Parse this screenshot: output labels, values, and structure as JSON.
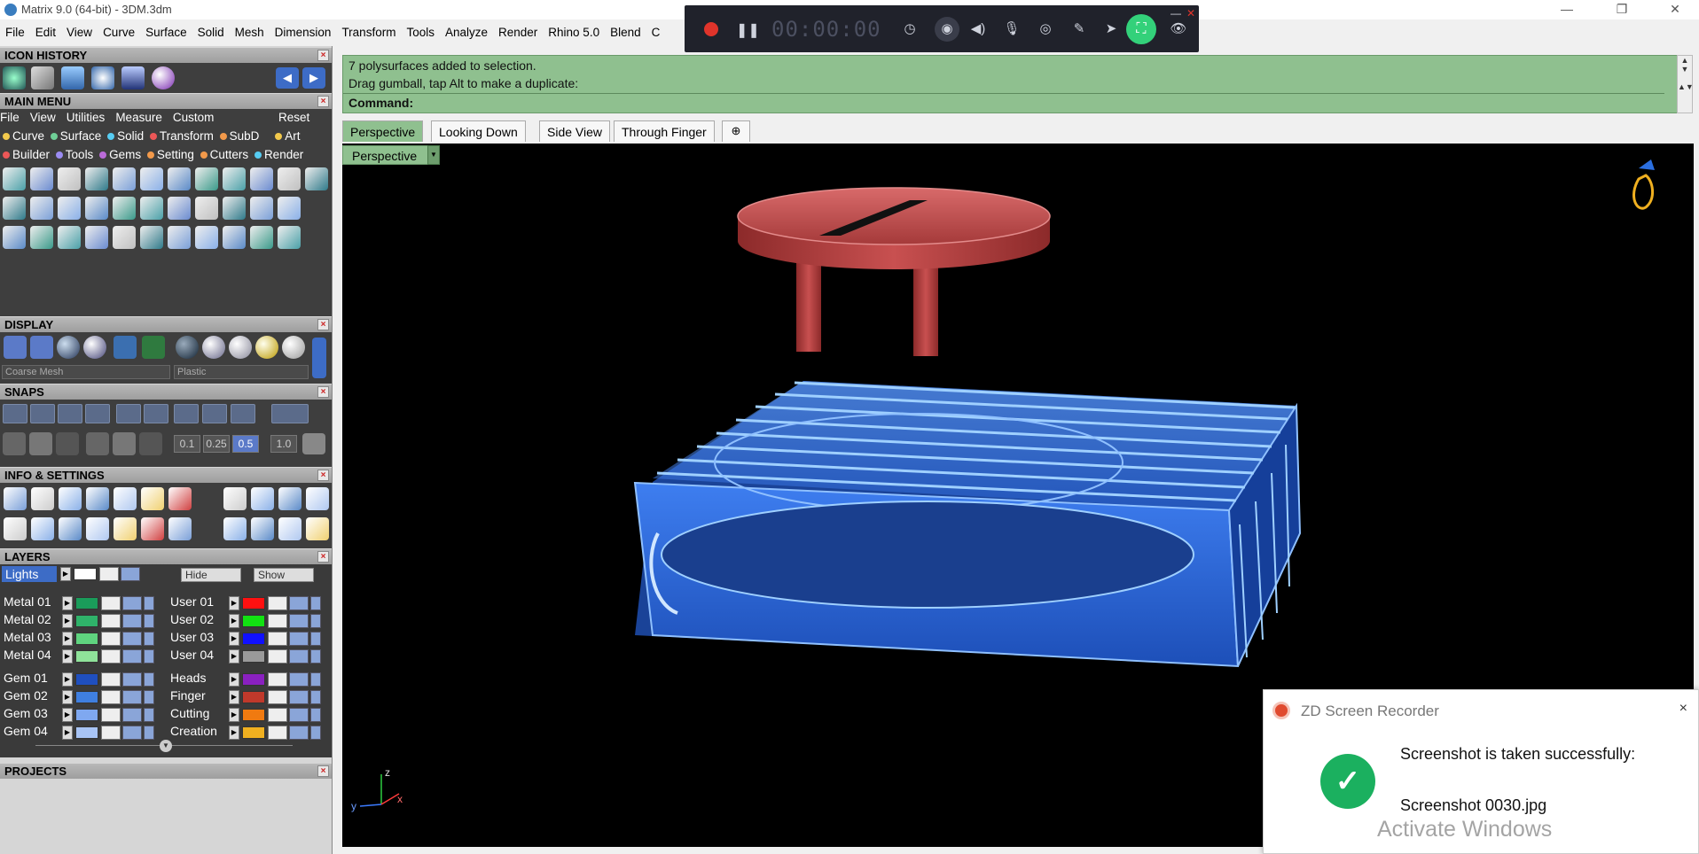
{
  "window": {
    "title": "Matrix 9.0 (64-bit) - 3DM.3dm",
    "minimize": "—",
    "restore": "❐",
    "close": "✕"
  },
  "menubar": [
    "File",
    "Edit",
    "View",
    "Curve",
    "Surface",
    "Solid",
    "Mesh",
    "Dimension",
    "Transform",
    "Tools",
    "Analyze",
    "Render",
    "Rhino 5.0",
    "Blend",
    "C"
  ],
  "recorder_toolbar": {
    "time": "00:00:00",
    "icons": [
      "clock-icon",
      "camera-icon",
      "speaker-icon",
      "microphone-icon",
      "webcam-icon",
      "pen-icon",
      "pointer-icon",
      "fullscreen-icon",
      "eye-icon"
    ],
    "accent": "#33d17a"
  },
  "panels": {
    "icon_history": "ICON HISTORY",
    "main_menu": "MAIN MENU",
    "display": "DISPLAY",
    "snaps": "SNAPS",
    "info_settings": "INFO & SETTINGS",
    "layers": "LAYERS",
    "projects": "PROJECTS"
  },
  "main_menu": {
    "items": [
      "File",
      "View",
      "Utilities",
      "Measure",
      "Custom"
    ],
    "reset": "Reset",
    "categories_row1": [
      {
        "label": "Curve",
        "color": "#f2c94c"
      },
      {
        "label": "Surface",
        "color": "#6fcf97"
      },
      {
        "label": "Solid",
        "color": "#56ccf2"
      },
      {
        "label": "Transform",
        "color": "#eb5757"
      },
      {
        "label": "SubD",
        "color": "#f2994a"
      },
      {
        "label": "Art",
        "color": "#f2c94c"
      }
    ],
    "categories_row2": [
      {
        "label": "Builder",
        "color": "#eb5757"
      },
      {
        "label": "Tools",
        "color": "#9b8cf2"
      },
      {
        "label": "Gems",
        "color": "#bb6bd9"
      },
      {
        "label": "Setting",
        "color": "#f2994a"
      },
      {
        "label": "Cutters",
        "color": "#f2994a"
      },
      {
        "label": "Render",
        "color": "#56ccf2"
      }
    ]
  },
  "display": {
    "mesh_select": "Coarse Mesh",
    "material_select": "Plastic"
  },
  "snaps": {
    "values": [
      "0.1",
      "0.25",
      "0.5",
      "1.0"
    ]
  },
  "layers": {
    "lights": "Lights",
    "hide": "Hide",
    "show": "Show",
    "left": [
      {
        "name": "Metal 01",
        "color": "#1a9c5a"
      },
      {
        "name": "Metal 02",
        "color": "#2fb36a"
      },
      {
        "name": "Metal 03",
        "color": "#5fd47f"
      },
      {
        "name": "Metal 04",
        "color": "#8fe29a"
      },
      {
        "name": "Gem 01",
        "color": "#1f4fbf"
      },
      {
        "name": "Gem 02",
        "color": "#3f7fe0"
      },
      {
        "name": "Gem 03",
        "color": "#7fa8f0"
      },
      {
        "name": "Gem 04",
        "color": "#a8c4f5"
      }
    ],
    "right": [
      {
        "name": "User 01",
        "color": "#ff1010"
      },
      {
        "name": "User 02",
        "color": "#12e212"
      },
      {
        "name": "User 03",
        "color": "#1010ff"
      },
      {
        "name": "User 04",
        "color": "#9a9a9a"
      },
      {
        "name": "Heads",
        "color": "#8a20c0"
      },
      {
        "name": "Finger",
        "color": "#c0392b"
      },
      {
        "name": "Cutting",
        "color": "#f07a10"
      },
      {
        "name": "Creation",
        "color": "#f0b020"
      }
    ]
  },
  "command": {
    "line1": "7 polysurfaces added to selection.",
    "line2": "Drag gumball, tap Alt to make a duplicate:",
    "prompt": "Command:"
  },
  "viewport_tabs": [
    {
      "label": "Perspective",
      "active": true
    },
    {
      "label": "Looking Down",
      "active": false
    },
    {
      "label": "Side View",
      "active": false
    },
    {
      "label": "Through Finger",
      "active": false
    }
  ],
  "viewport": {
    "label": "Perspective",
    "axis_x": "x",
    "axis_y": "y",
    "axis_z": "z"
  },
  "toast": {
    "app": "ZD Screen Recorder",
    "message": "Screenshot is taken successfully:",
    "file": "Screenshot 0030.jpg",
    "close": "×"
  },
  "watermark": "Activate Windows"
}
